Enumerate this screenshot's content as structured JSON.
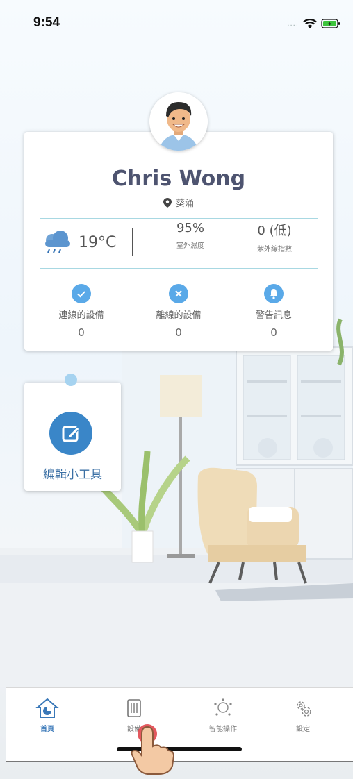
{
  "status_bar": {
    "time": "9:54"
  },
  "profile": {
    "name": "Chris Wong",
    "location": "葵涌"
  },
  "weather": {
    "temperature": "19°C",
    "humidity": {
      "value": "95%",
      "label": "室外濕度"
    },
    "uv": {
      "value": "0 (低)",
      "label": "紫外線指數"
    }
  },
  "devices": [
    {
      "label": "連線的設備",
      "count": "0",
      "icon": "check-icon"
    },
    {
      "label": "離線的設備",
      "count": "0",
      "icon": "cross-icon"
    },
    {
      "label": "警告訊息",
      "count": "0",
      "icon": "bell-icon"
    }
  ],
  "widget": {
    "label": "編輯小工具",
    "icon": "edit-icon"
  },
  "tabs": [
    {
      "label": "首頁",
      "icon": "home-icon",
      "active": true
    },
    {
      "label": "設備",
      "icon": "device-icon"
    },
    {
      "label": "智能操作",
      "icon": "smart-icon"
    },
    {
      "label": "設定",
      "icon": "gear-icon"
    }
  ],
  "colors": {
    "accent": "#3a86c8",
    "name_text": "#4e5470",
    "divider": "#a8d8e2"
  }
}
